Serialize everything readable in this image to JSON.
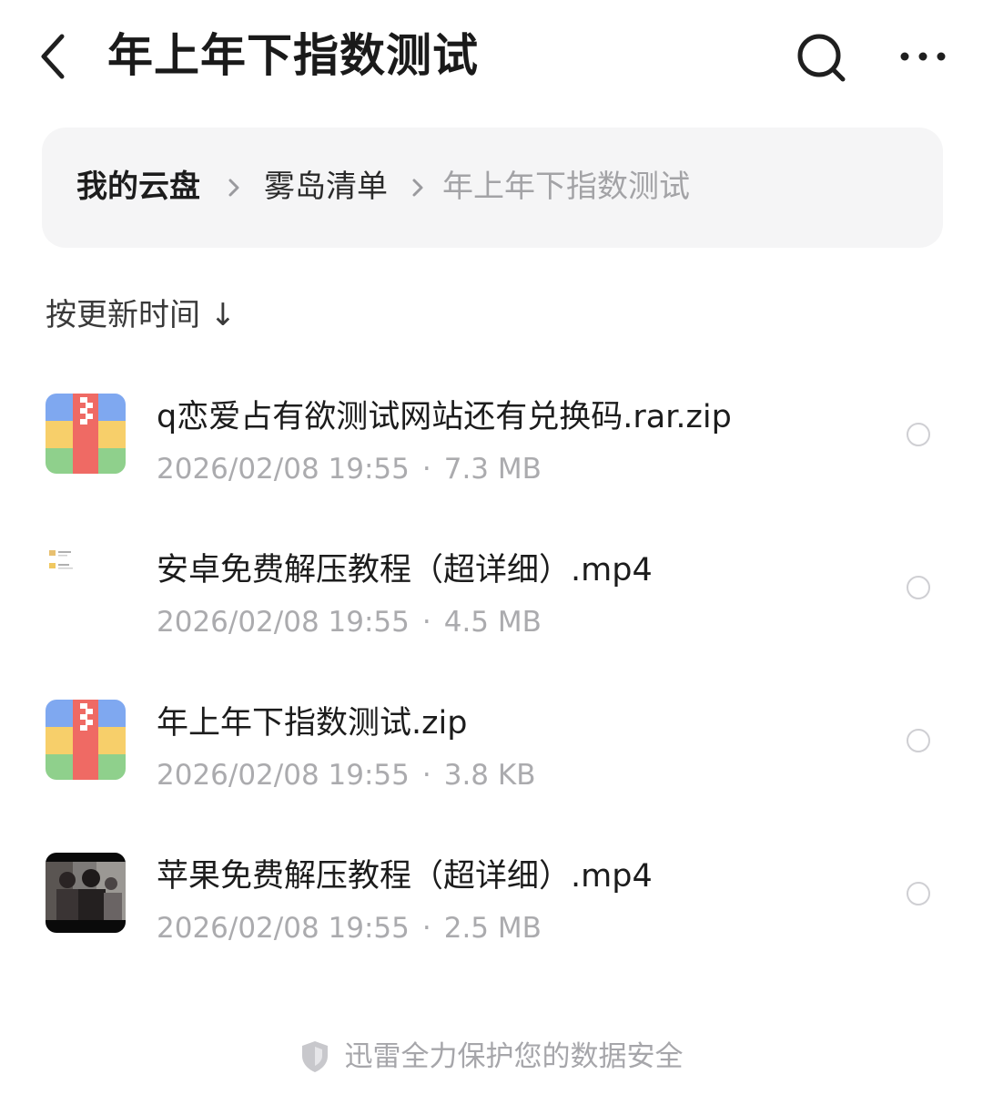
{
  "header": {
    "title": "年上年下指数测试",
    "back_icon": "chevron-left-icon",
    "search_icon": "search-icon",
    "more_icon": "more-horizontal-icon"
  },
  "breadcrumb": {
    "items": [
      "我的云盘",
      "雾岛清单",
      "年上年下指数测试"
    ],
    "separator_icon": "chevron-right-icon"
  },
  "sort": {
    "label": "按更新时间 ↓"
  },
  "files": [
    {
      "name": "q恋爱占有欲测试网站还有兑换码.rar.zip",
      "date": "2026/02/08 19:55",
      "size": "7.3 MB",
      "icon": "zip-archive-icon"
    },
    {
      "name": "安卓免费解压教程（超详细）.mp4",
      "date": "2026/02/08 19:55",
      "size": "4.5 MB",
      "icon": "video-thumbnail"
    },
    {
      "name": "年上年下指数测试.zip",
      "date": "2026/02/08 19:55",
      "size": "3.8 KB",
      "icon": "zip-archive-icon"
    },
    {
      "name": "苹果免费解压教程（超详细）.mp4",
      "date": "2026/02/08 19:55",
      "size": "2.5 MB",
      "icon": "video-thumbnail"
    }
  ],
  "meta_separator": "·",
  "footer": {
    "text": "迅雷全力保护您的数据安全",
    "icon": "shield-icon"
  },
  "colors": {
    "zip_blue": "#7fa8f0",
    "zip_yellow": "#f7cf6a",
    "zip_green": "#8fd08c",
    "zip_red": "#ef6a64",
    "muted_text": "#ababae",
    "breadcrumb_bg": "#f5f5f6"
  }
}
